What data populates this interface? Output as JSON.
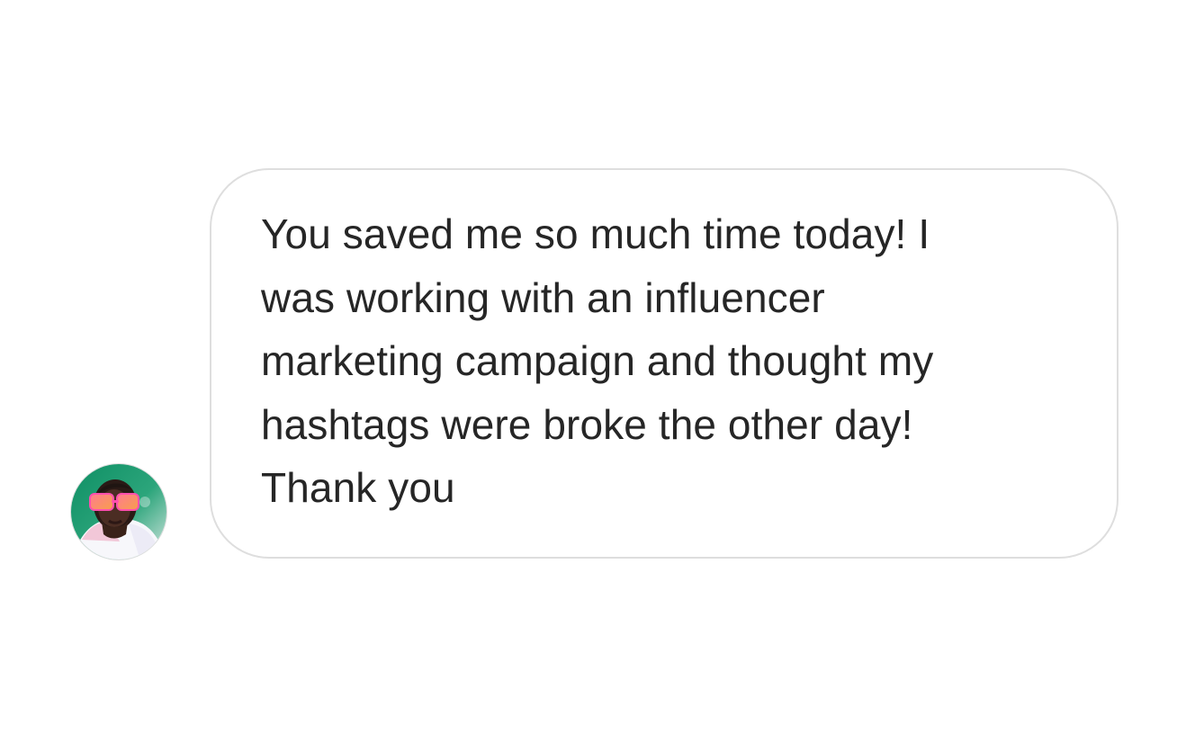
{
  "conversation": {
    "message": {
      "text": "You saved me so much time today! I\nwas working with an influencer\nmarketing campaign and thought my\nhashtags were broke the other day!\nThank you"
    },
    "sender": {
      "avatar_icon": "profile-photo-avatar"
    }
  },
  "colors": {
    "background": "#ffffff",
    "bubble_border": "#dedede",
    "text": "#262626"
  }
}
